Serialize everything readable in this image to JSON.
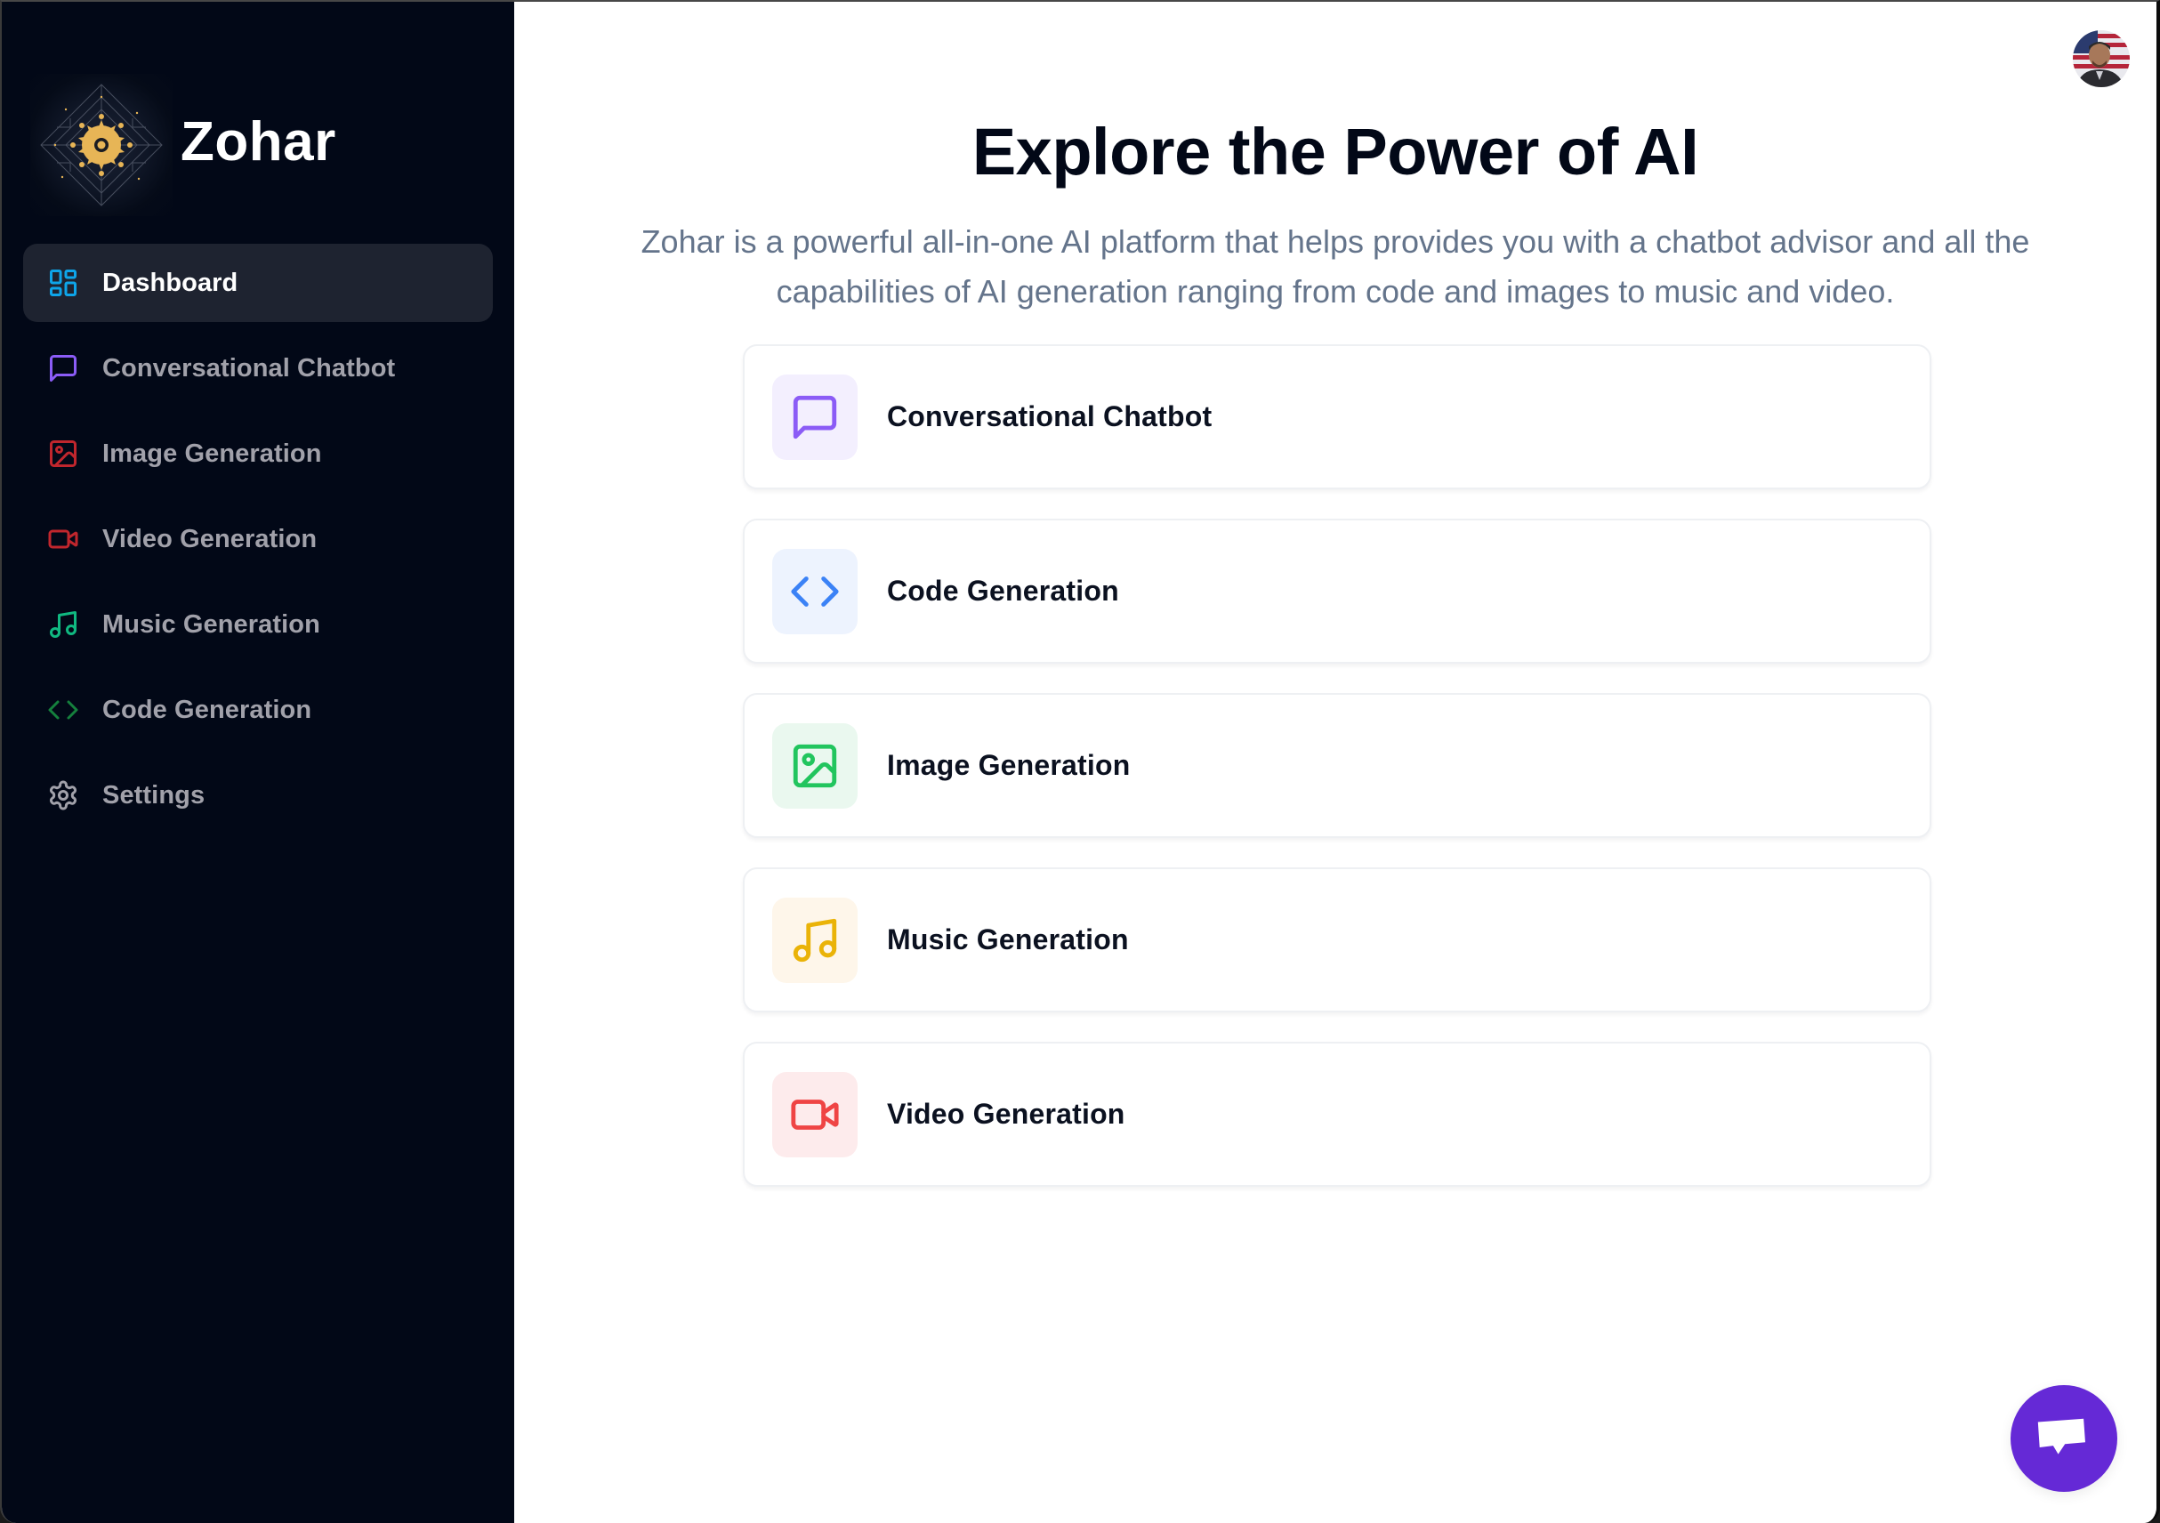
{
  "brand": {
    "name": "Zohar",
    "logo_icon": "ai-circuit-logo"
  },
  "sidebar": {
    "items": [
      {
        "label": "Dashboard",
        "icon": "layout-dashboard-icon",
        "color": "#0EA5E9",
        "active": true
      },
      {
        "label": "Conversational Chatbot",
        "icon": "message-square-icon",
        "color": "#8B5CF6",
        "active": false
      },
      {
        "label": "Image Generation",
        "icon": "image-icon",
        "color": "#C0262D",
        "active": false
      },
      {
        "label": "Video Generation",
        "icon": "video-icon",
        "color": "#C0262D",
        "active": false
      },
      {
        "label": "Music Generation",
        "icon": "music-icon",
        "color": "#10B981",
        "active": false
      },
      {
        "label": "Code Generation",
        "icon": "code-icon",
        "color": "#15803D",
        "active": false
      },
      {
        "label": "Settings",
        "icon": "settings-icon",
        "color": "#A1A1AA",
        "active": false
      }
    ]
  },
  "header": {
    "avatar": "user-avatar"
  },
  "main": {
    "title": "Explore the Power of AI",
    "subtitle": "Zohar is a powerful all-in-one AI platform that helps provides you with a chatbot advisor and all the capabilities of AI generation ranging from code and images to music and video.",
    "tools": [
      {
        "label": "Conversational Chatbot",
        "icon": "message-square-icon",
        "color": "#8B5CF6",
        "bg": "#F3EFFE"
      },
      {
        "label": "Code Generation",
        "icon": "code-icon",
        "color": "#3B82F6",
        "bg": "#EDF3FE"
      },
      {
        "label": "Image Generation",
        "icon": "image-icon",
        "color": "#22C55E",
        "bg": "#EAF8EF"
      },
      {
        "label": "Music Generation",
        "icon": "music-icon",
        "color": "#EAB308",
        "bg": "#FEF6EA"
      },
      {
        "label": "Video Generation",
        "icon": "video-icon",
        "color": "#EF4444",
        "bg": "#FDEBEC"
      }
    ]
  },
  "chat_widget": {
    "icon": "chat-bubble-icon",
    "color": "#6529D6"
  }
}
